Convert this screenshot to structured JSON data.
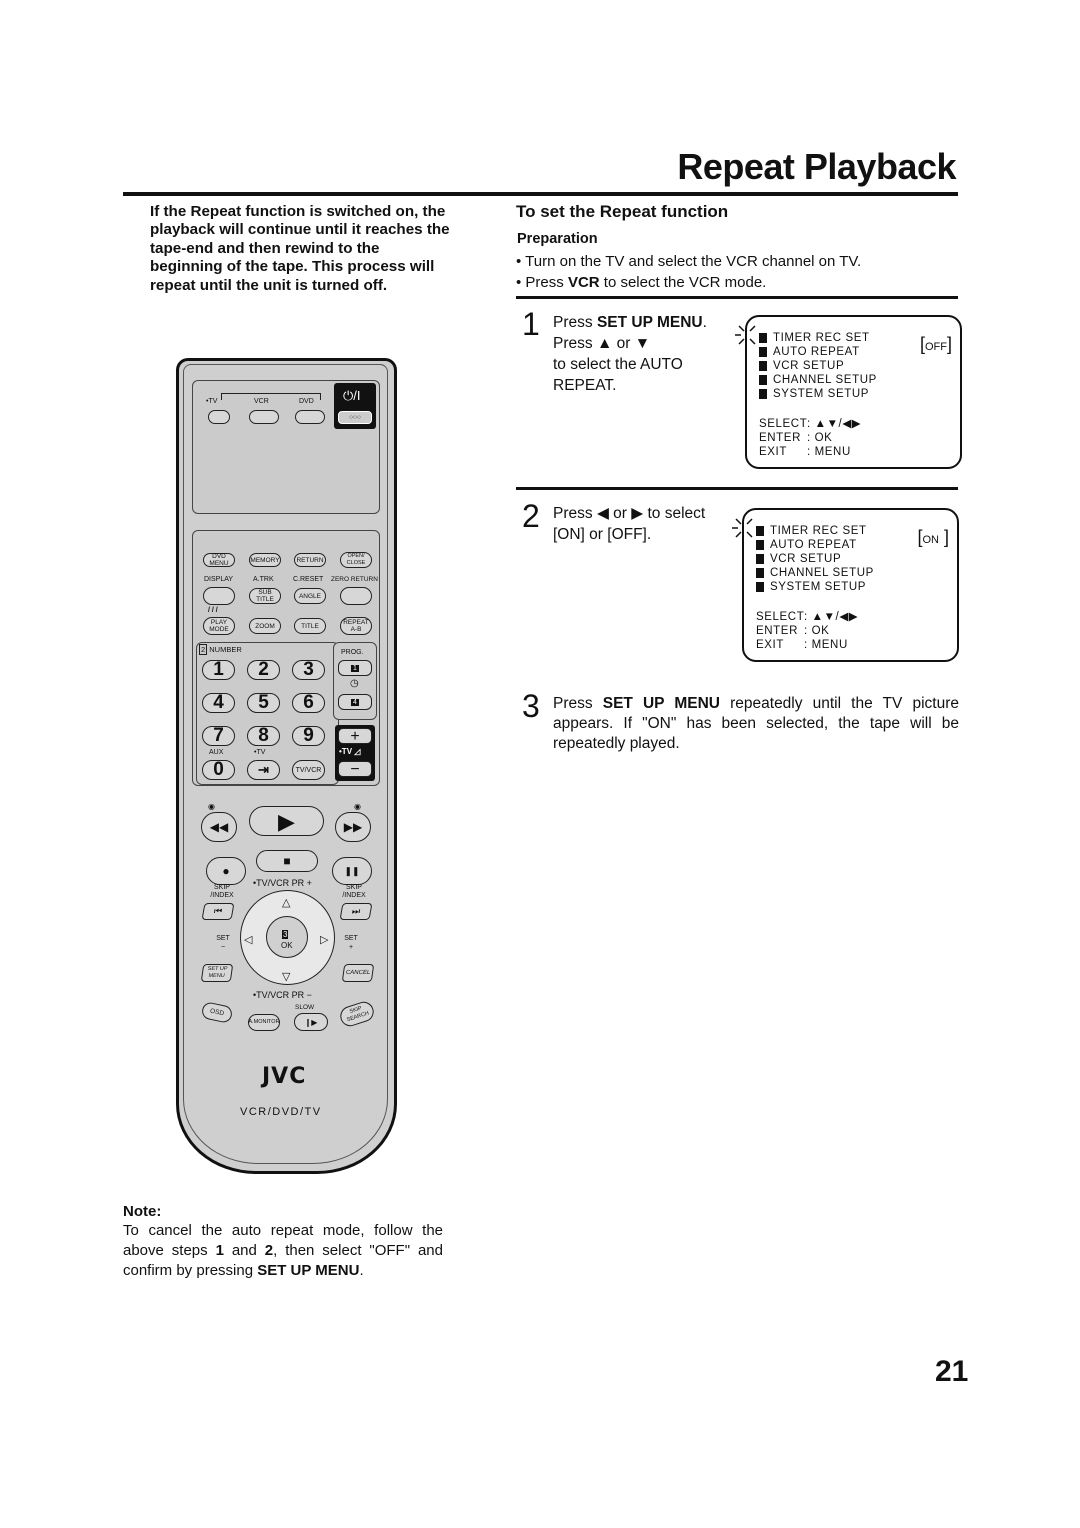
{
  "header": {
    "title": "Repeat Playback"
  },
  "intro": "If the Repeat function is switched on, the playback will continue until it reaches the tape-end and then rewind to the beginning of the tape. This process will repeat until the unit is turned off.",
  "section": {
    "title": "To set the Repeat function",
    "preparation_label": "Preparation",
    "preparation": [
      "Turn on the TV and select the VCR channel on TV.",
      {
        "pre": "Press ",
        "bold": "VCR",
        "post": " to select the VCR mode."
      }
    ]
  },
  "steps": [
    {
      "number": "1",
      "lines": [
        {
          "pre": "Press ",
          "bold": "SET UP MENU",
          "post": "."
        },
        {
          "pre": "Press ",
          "icon1": "▲",
          "mid": " or ",
          "icon2": "▼"
        },
        {
          "text": "to select the AUTO"
        },
        {
          "text": "REPEAT."
        }
      ],
      "osd": {
        "items": [
          "TIMER  REC  SET",
          "AUTO  REPEAT",
          "VCR  SETUP",
          "CHANNEL  SETUP",
          "SYSTEM  SETUP"
        ],
        "value": "OFF",
        "legend": [
          {
            "key": "SELECT",
            "val": ": ▲▼/◀▶"
          },
          {
            "key": "ENTER",
            "val": ": OK"
          },
          {
            "key": "EXIT",
            "val": ": MENU"
          }
        ]
      }
    },
    {
      "number": "2",
      "lines": [
        {
          "pre": "Press ",
          "icon1": "◀",
          "mid": "  or ",
          "icon2": "▶",
          "post": "  to select"
        },
        {
          "text": "[ON] or [OFF]."
        }
      ],
      "osd": {
        "items": [
          "TIMER  REC  SET",
          "AUTO  REPEAT",
          "VCR  SETUP",
          "CHANNEL  SETUP",
          "SYSTEM  SETUP"
        ],
        "value": "ON",
        "legend": [
          {
            "key": "SELECT",
            "val": ": ▲▼/◀▶"
          },
          {
            "key": "ENTER",
            "val": ": OK"
          },
          {
            "key": "EXIT",
            "val": ": MENU"
          }
        ]
      }
    },
    {
      "number": "3",
      "pre": "Press ",
      "bold": "SET UP MENU",
      "post": " repeatedly until the TV picture appears. If \"ON\" has been selected, the tape will be repeatedly played."
    }
  ],
  "remote": {
    "mode_labels": [
      "•TV",
      "VCR",
      "DVD"
    ],
    "power": "⏻/I",
    "power_sub": "○○○",
    "row1": [
      "DVD MENU",
      "MEMORY",
      "RETURN",
      "OPEN/ CLOSE"
    ],
    "row2_labels": [
      "DISPLAY",
      "A.TRK",
      "C.RESET",
      "ZERO RETURN"
    ],
    "row2": [
      "",
      "SUB TITLE",
      "ANGLE",
      ""
    ],
    "row3_label": "/ / /",
    "row3": [
      "PLAY MODE",
      "ZOOM",
      "TITLE",
      "REPEAT A-B"
    ],
    "number_label": "NUMBER",
    "number_badge": "2",
    "numbers": [
      "1",
      "2",
      "3",
      "4",
      "5",
      "6",
      "7",
      "8",
      "9"
    ],
    "aux_label": "AUX",
    "tv_label": "•TV",
    "zero": "0",
    "input_icon": "⇥",
    "tvvcr": "TV/VCR",
    "prog_label": "PROG.",
    "prog_buttons": [
      "1",
      "4"
    ],
    "timer_icon": "◷",
    "vol_plus": "+",
    "vol_label": "•TV ◿",
    "vol_minus": "−",
    "transport": {
      "rew": "◀◀",
      "play": "▶",
      "ff": "▶▶",
      "rec": "●",
      "stop": "■",
      "pause": "❚❚"
    },
    "skip_left": "SKIP /INDEX",
    "skip_right": "SKIP /INDEX",
    "skip_left_icon": "⏮",
    "skip_right_icon": "⏭",
    "ring_top": "•TV/VCR PR +",
    "ring_bottom": "•TV/VCR PR −",
    "set_minus": "SET −",
    "set_plus": "SET +",
    "ok_badge": "3",
    "ok": "OK",
    "setup_menu": "SET UP MENU",
    "cancel": "CANCEL",
    "osd": "OSD",
    "amonitor": "A.MONITOR",
    "slow_label": "SLOW",
    "slow_icon": "❙▶",
    "skip_search": "SKIP SEARCH",
    "brand": "JVC",
    "model": "VCR/DVD/TV"
  },
  "note": {
    "label": "Note:",
    "parts": [
      {
        "t": "To cancel the auto repeat mode, follow the above steps "
      },
      {
        "b": "1"
      },
      {
        "t": " and "
      },
      {
        "b": "2"
      },
      {
        "t": ", then select \"OFF\" and confirm by pressing "
      },
      {
        "b": "SET UP MENU"
      },
      {
        "t": "."
      }
    ]
  },
  "page_number": "21"
}
